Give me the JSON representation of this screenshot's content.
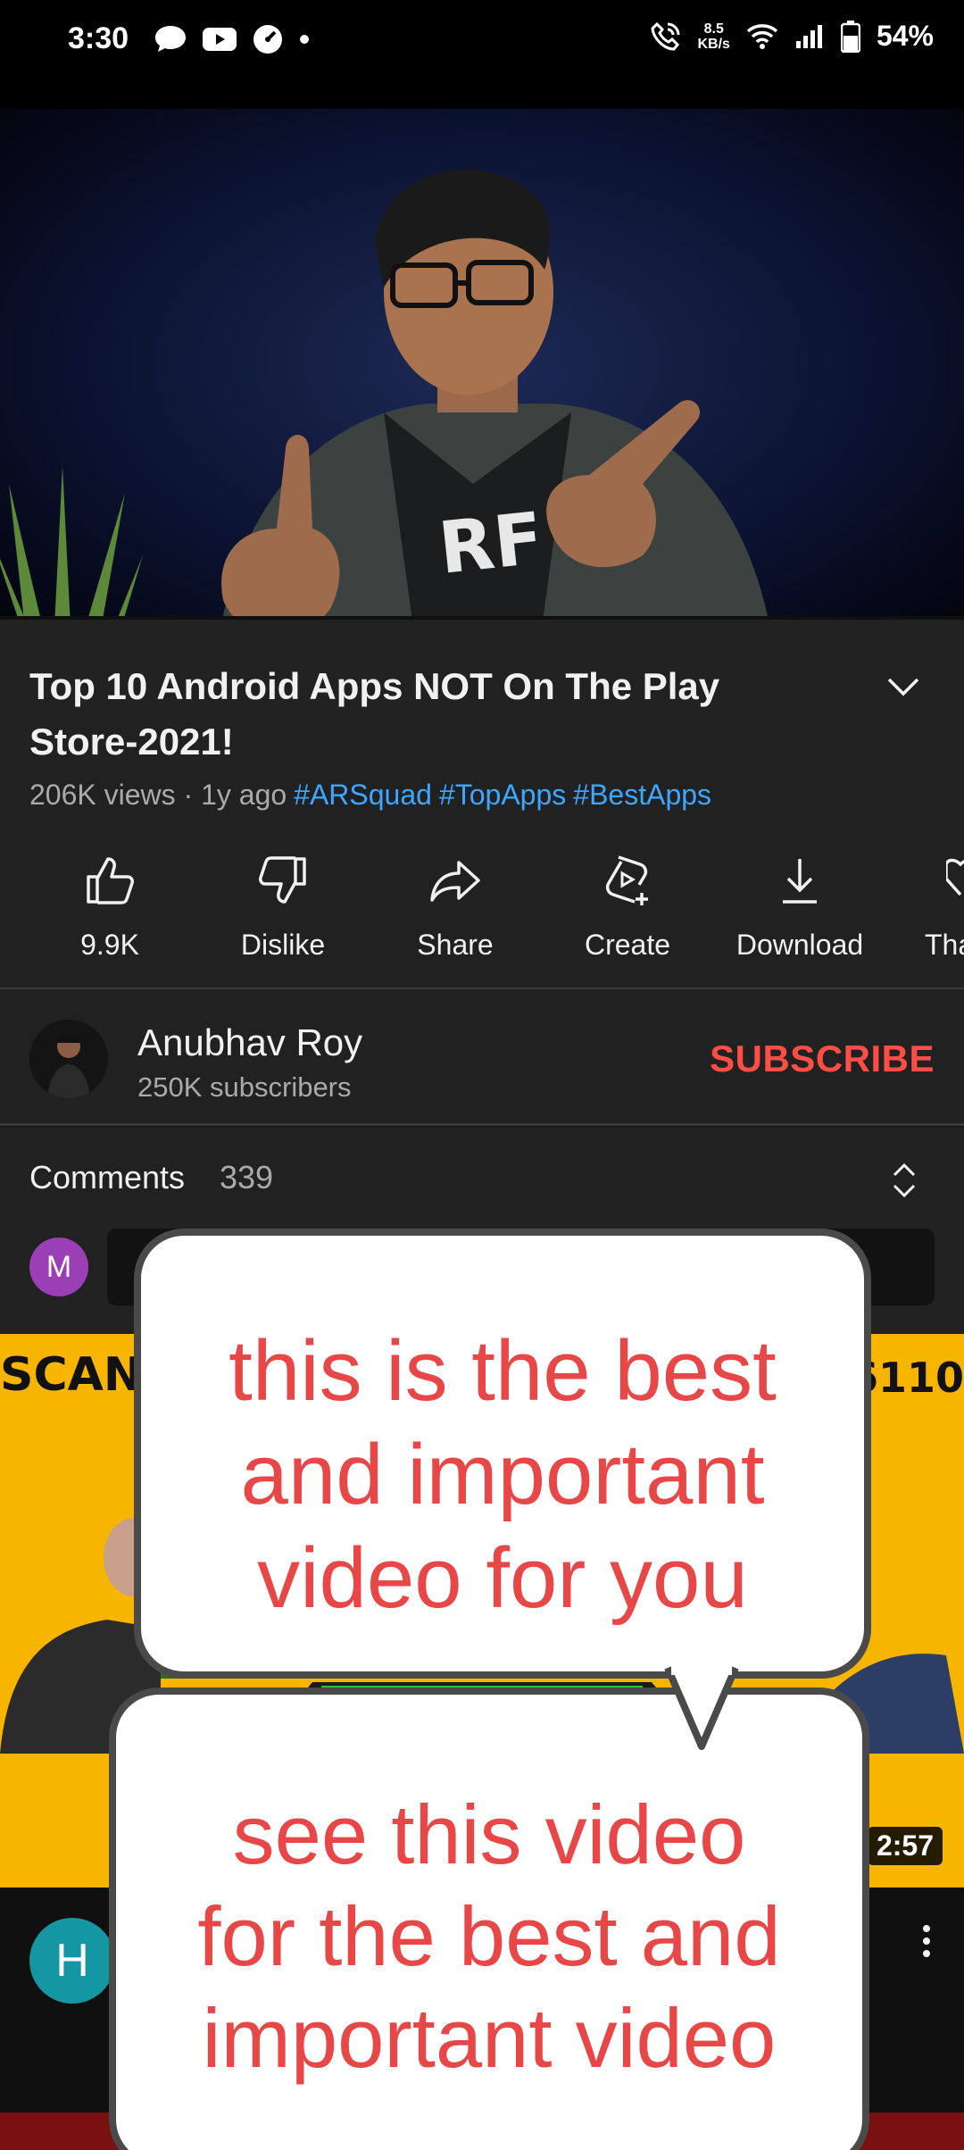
{
  "status_bar": {
    "time": "3:30",
    "net_speed_value": "8.5",
    "net_speed_unit": "KB/s",
    "battery": "54%"
  },
  "video": {
    "title": "Top 10 Android Apps NOT On The Play Store-2021!",
    "views_age": "206K views · 1y ago",
    "hashtags": [
      "#ARSquad",
      "#TopApps",
      "#BestApps"
    ],
    "progress_fraction": 0.93,
    "actions": [
      {
        "label": "9.9K",
        "icon": "thumb-up-icon"
      },
      {
        "label": "Dislike",
        "icon": "thumb-down-icon"
      },
      {
        "label": "Share",
        "icon": "share-icon"
      },
      {
        "label": "Create",
        "icon": "create-icon"
      },
      {
        "label": "Download",
        "icon": "download-icon"
      },
      {
        "label": "Tha",
        "icon": "thanks-icon"
      }
    ]
  },
  "channel": {
    "name": "Anubhav Roy",
    "subscribers": "250K subscribers",
    "subscribe_label": "SUBSCRIBE"
  },
  "comments": {
    "title": "Comments",
    "count": "339",
    "user_initial": "M"
  },
  "next_video": {
    "thumb_text_left": "SCAN",
    "thumb_text_right": "6110",
    "duration": "2:57",
    "channel_initial": "H"
  },
  "overlays": {
    "bubble_top": [
      "this is the best",
      "and important",
      "video for you"
    ],
    "bubble_bottom": [
      "see this video",
      "for the best and",
      "important video"
    ]
  },
  "colors": {
    "accent_red": "#ff4e45",
    "hashtag_blue": "#3ea6ff",
    "bubble_text": "#e84747"
  }
}
